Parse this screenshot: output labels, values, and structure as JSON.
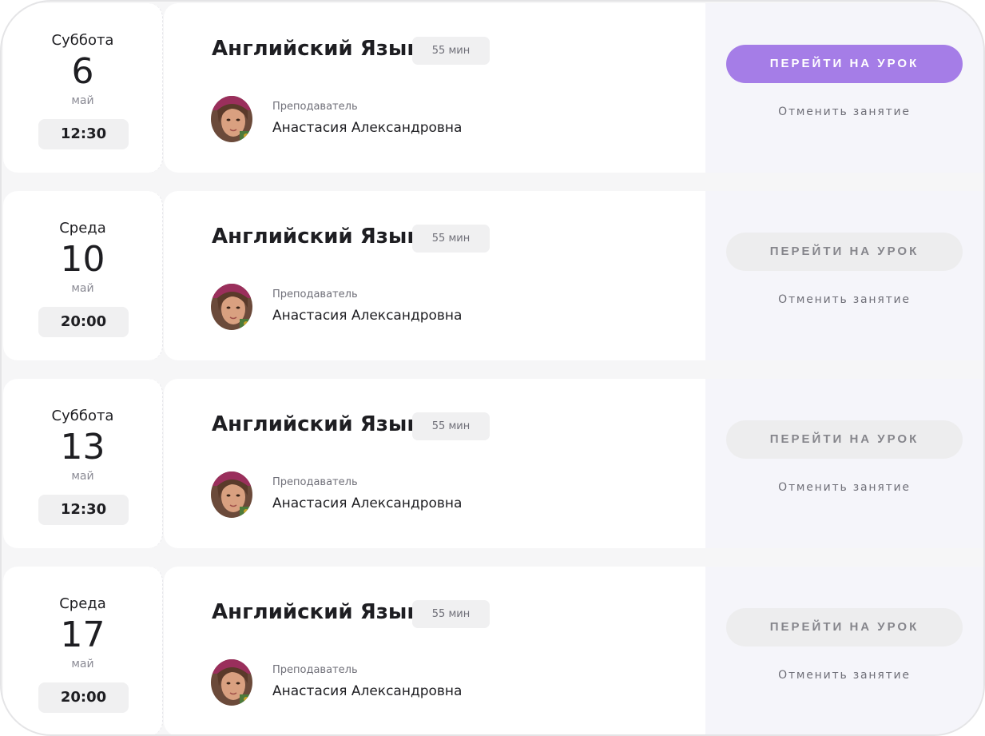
{
  "lessons": [
    {
      "weekday": "Суббота",
      "day": "6",
      "month": "май",
      "time": "12:30",
      "subject": "Английский Язык",
      "duration": "55 мин",
      "teacher_label": "Преподаватель",
      "teacher_name": "Анастасия Александровна",
      "go_label": "ПЕРЕЙТИ НА УРОК",
      "go_enabled": true,
      "cancel_label": "Отменить занятие"
    },
    {
      "weekday": "Среда",
      "day": "10",
      "month": "май",
      "time": "20:00",
      "subject": "Английский Язык",
      "duration": "55 мин",
      "teacher_label": "Преподаватель",
      "teacher_name": "Анастасия Александровна",
      "go_label": "ПЕРЕЙТИ НА УРОК",
      "go_enabled": false,
      "cancel_label": "Отменить занятие"
    },
    {
      "weekday": "Суббота",
      "day": "13",
      "month": "май",
      "time": "12:30",
      "subject": "Английский Язык",
      "duration": "55 мин",
      "teacher_label": "Преподаватель",
      "teacher_name": "Анастасия Александровна",
      "go_label": "ПЕРЕЙТИ НА УРОК",
      "go_enabled": false,
      "cancel_label": "Отменить занятие"
    },
    {
      "weekday": "Среда",
      "day": "17",
      "month": "май",
      "time": "20:00",
      "subject": "Английский Язык",
      "duration": "55 мин",
      "teacher_label": "Преподаватель",
      "teacher_name": "Анастасия Александровна",
      "go_label": "ПЕРЕЙТИ НА УРОК",
      "go_enabled": false,
      "cancel_label": "Отменить занятие"
    }
  ],
  "colors": {
    "accent": "#a57de7",
    "panel": "#f5f5fa",
    "chip": "#f0f0f1",
    "text": "#1e1e22",
    "muted": "#6f6f78"
  },
  "icons": {
    "avatar": "teacher-avatar-photo"
  }
}
